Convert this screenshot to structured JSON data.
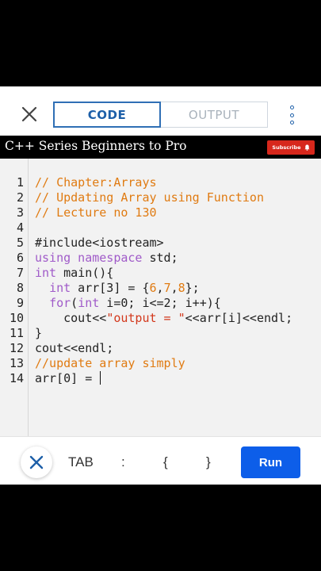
{
  "tabs": {
    "code": "CODE",
    "output": "OUTPUT"
  },
  "banner": {
    "title": "C++ Series Beginners to Pro",
    "subscribe": "Subscribe"
  },
  "editor": {
    "lines": [
      {
        "n": "1",
        "segs": [
          [
            "c",
            "// Chapter:Arrays"
          ]
        ]
      },
      {
        "n": "2",
        "segs": [
          [
            "c",
            "// Updating Array using Function"
          ]
        ]
      },
      {
        "n": "3",
        "segs": [
          [
            "c",
            "// Lecture no 130"
          ]
        ]
      },
      {
        "n": "4",
        "segs": []
      },
      {
        "n": "5",
        "segs": [
          [
            "p",
            "#include<iostream>"
          ]
        ]
      },
      {
        "n": "6",
        "segs": [
          [
            "k",
            "using namespace"
          ],
          [
            "p",
            " std;"
          ]
        ]
      },
      {
        "n": "7",
        "segs": [
          [
            "k",
            "int"
          ],
          [
            "p",
            " main(){"
          ]
        ]
      },
      {
        "n": "8",
        "segs": [
          [
            "p",
            "  "
          ],
          [
            "k",
            "int"
          ],
          [
            "p",
            " arr[3] = {"
          ],
          [
            "n",
            "6"
          ],
          [
            "p",
            ","
          ],
          [
            "n",
            "7"
          ],
          [
            "p",
            ","
          ],
          [
            "n",
            "8"
          ],
          [
            "p",
            "};"
          ]
        ]
      },
      {
        "n": "9",
        "segs": [
          [
            "p",
            "  "
          ],
          [
            "k",
            "for"
          ],
          [
            "p",
            "("
          ],
          [
            "k",
            "int"
          ],
          [
            "p",
            " i=0; i<=2; i++){"
          ]
        ]
      },
      {
        "n": "10",
        "segs": [
          [
            "p",
            "    cout<<"
          ],
          [
            "s",
            "\"output = \""
          ],
          [
            "p",
            "<<arr[i]<<endl;"
          ]
        ]
      },
      {
        "n": "11",
        "segs": [
          [
            "p",
            "}"
          ]
        ]
      },
      {
        "n": "12",
        "segs": [
          [
            "p",
            "cout<<endl;"
          ]
        ]
      },
      {
        "n": "13",
        "segs": [
          [
            "c",
            "//update array simply"
          ]
        ]
      },
      {
        "n": "14",
        "segs": [
          [
            "p",
            "arr[0] = "
          ]
        ],
        "caret": true
      }
    ]
  },
  "keys": {
    "tab": "TAB",
    "colon": ":",
    "brace_open": "{",
    "brace_close": "}",
    "run": "Run"
  }
}
